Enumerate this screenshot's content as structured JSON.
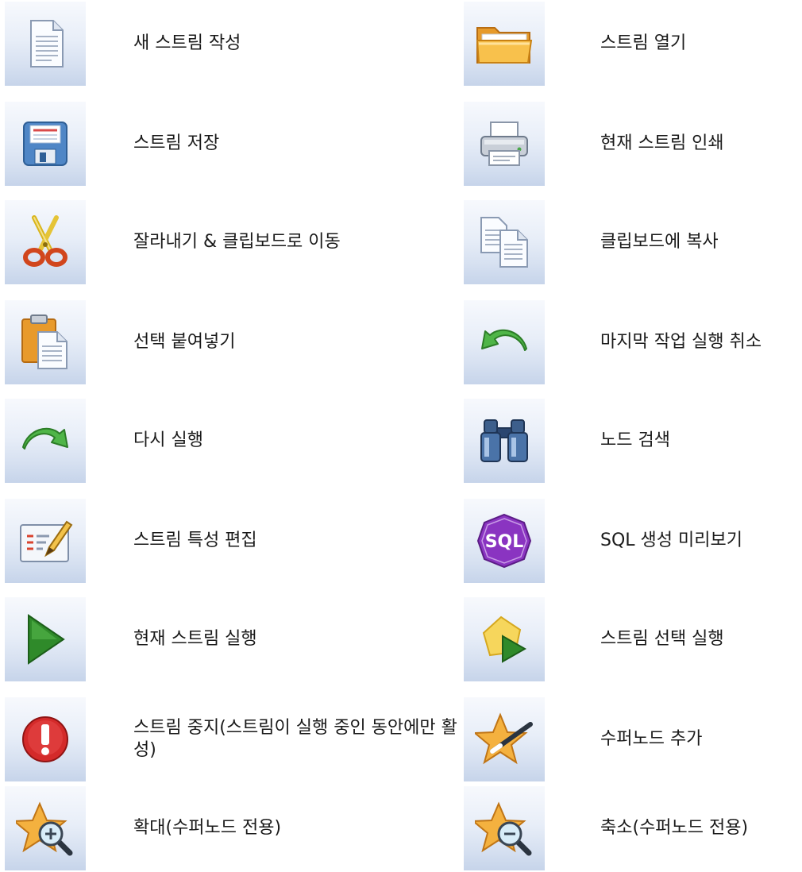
{
  "items": [
    {
      "icon": "new-document-icon",
      "label": "새 스트림 작성"
    },
    {
      "icon": "open-folder-icon",
      "label": "스트림 열기"
    },
    {
      "icon": "save-disk-icon",
      "label": "스트림 저장"
    },
    {
      "icon": "printer-icon",
      "label": "현재 스트림 인쇄"
    },
    {
      "icon": "scissors-icon",
      "label": "잘라내기 & 클립보드로 이동"
    },
    {
      "icon": "copy-icon",
      "label": "클립보드에 복사"
    },
    {
      "icon": "paste-icon",
      "label": "선택 붙여넣기"
    },
    {
      "icon": "undo-icon",
      "label": "마지막 작업 실행 취소"
    },
    {
      "icon": "redo-icon",
      "label": "다시 실행"
    },
    {
      "icon": "binoculars-icon",
      "label": "노드 검색"
    },
    {
      "icon": "edit-properties-icon",
      "label": "스트림 특성 편집"
    },
    {
      "icon": "sql-icon",
      "label": "SQL 생성 미리보기",
      "icon_text": "SQL"
    },
    {
      "icon": "run-icon",
      "label": "현재 스트림 실행"
    },
    {
      "icon": "run-selection-icon",
      "label": "스트림 선택 실행"
    },
    {
      "icon": "stop-icon",
      "label": "스트림 중지(스트림이 실행 중인 동안에만 활성)"
    },
    {
      "icon": "add-supernode-icon",
      "label": "수퍼노드 추가"
    },
    {
      "icon": "zoom-in-supernode-icon",
      "label": "확대(수퍼노드 전용)"
    },
    {
      "icon": "zoom-out-supernode-icon",
      "label": "축소(수퍼노드 전용)"
    }
  ],
  "colors": {
    "tile_top": "#f7f9fd",
    "tile_bottom": "#c6d4ea",
    "text": "#1a1a1a"
  }
}
